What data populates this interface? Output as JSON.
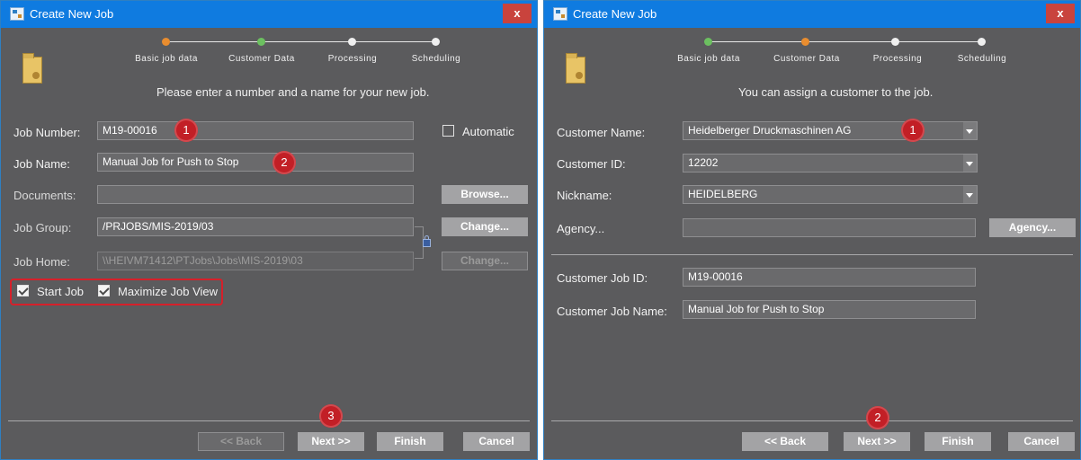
{
  "window_title": "Create New Job",
  "close_label": "x",
  "steps": [
    "Basic job data",
    "Customer Data",
    "Processing",
    "Scheduling"
  ],
  "panel1": {
    "message": "Please enter a number and a name for your new job.",
    "fields": {
      "job_number_label": "Job Number:",
      "job_number": "M19-00016",
      "automatic_label": "Automatic",
      "job_name_label": "Job Name:",
      "job_name": "Manual Job for Push to Stop",
      "documents_label": "Documents:",
      "documents": "",
      "job_group_label": "Job Group:",
      "job_group": "/PRJOBS/MIS-2019/03",
      "job_home_label": "Job Home:",
      "job_home": "\\\\HEIVM71412\\PTJobs\\Jobs\\MIS-2019\\03"
    },
    "buttons": {
      "browse": "Browse...",
      "change": "Change...",
      "change_disabled": "Change..."
    },
    "checkboxes": {
      "start_job": "Start Job",
      "maximize": "Maximize Job View"
    },
    "footer": {
      "back": "<< Back",
      "next": "Next >>",
      "finish": "Finish",
      "cancel": "Cancel"
    },
    "badges": [
      "1",
      "2",
      "3"
    ]
  },
  "panel2": {
    "message": "You can assign a customer to the job.",
    "fields": {
      "customer_name_label": "Customer Name:",
      "customer_name": "Heidelberger Druckmaschinen AG",
      "customer_id_label": "Customer ID:",
      "customer_id": "12202",
      "nickname_label": "Nickname:",
      "nickname": "HEIDELBERG",
      "agency_label": "Agency...",
      "agency": "",
      "customer_job_id_label": "Customer Job ID:",
      "customer_job_id": "M19-00016",
      "customer_job_name_label": "Customer Job Name:",
      "customer_job_name": "Manual Job for Push to Stop"
    },
    "buttons": {
      "agency": "Agency..."
    },
    "footer": {
      "back": "<< Back",
      "next": "Next >>",
      "finish": "Finish",
      "cancel": "Cancel"
    },
    "badges": [
      "1",
      "2"
    ]
  },
  "colors": {
    "titlebar": "#0f7be0",
    "panel_bg": "#5b5b5d",
    "step_current": "#e98d2f",
    "step_done": "#6cc060",
    "step_pending": "#efefef",
    "badge": "#c21f26",
    "close_button": "#c9433d"
  },
  "icons": [
    "app-icon",
    "close-icon",
    "folder-icon",
    "lock-icon",
    "chevron-down-icon"
  ]
}
